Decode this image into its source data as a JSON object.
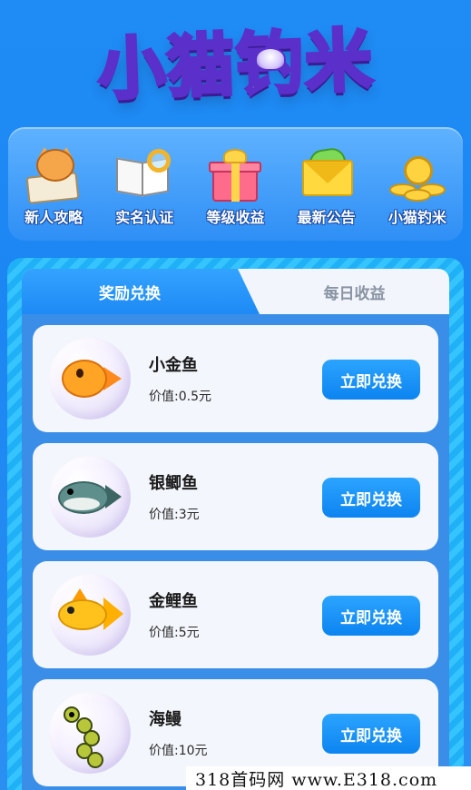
{
  "app": {
    "title": "小猫钓米"
  },
  "menu": {
    "items": [
      {
        "label": "新人攻略",
        "icon": "cat-guide-icon"
      },
      {
        "label": "实名认证",
        "icon": "book-magnifier-icon"
      },
      {
        "label": "等级收益",
        "icon": "gift-box-icon"
      },
      {
        "label": "最新公告",
        "icon": "envelope-icon"
      },
      {
        "label": "小猫钓米",
        "icon": "gold-coins-icon"
      }
    ]
  },
  "tabs": {
    "active": "奖励兑换",
    "inactive": "每日收益"
  },
  "rewards": [
    {
      "name": "小金鱼",
      "price": "价值:0.5元",
      "button": "立即兑换",
      "icon": "goldfish-icon"
    },
    {
      "name": "银鲫鱼",
      "price": "价值:3元",
      "button": "立即兑换",
      "icon": "silver-crucian-icon"
    },
    {
      "name": "金鲤鱼",
      "price": "价值:5元",
      "button": "立即兑换",
      "icon": "golden-carp-icon"
    },
    {
      "name": "海鳗",
      "price": "价值:10元",
      "button": "立即兑换",
      "icon": "sea-eel-icon"
    }
  ],
  "watermark": "318首码网 www.E318.com",
  "colors": {
    "background": "#1f8cf5",
    "button": "#0c84f0",
    "tab_active": "#1d8af5",
    "card": "#f3f6fc"
  }
}
